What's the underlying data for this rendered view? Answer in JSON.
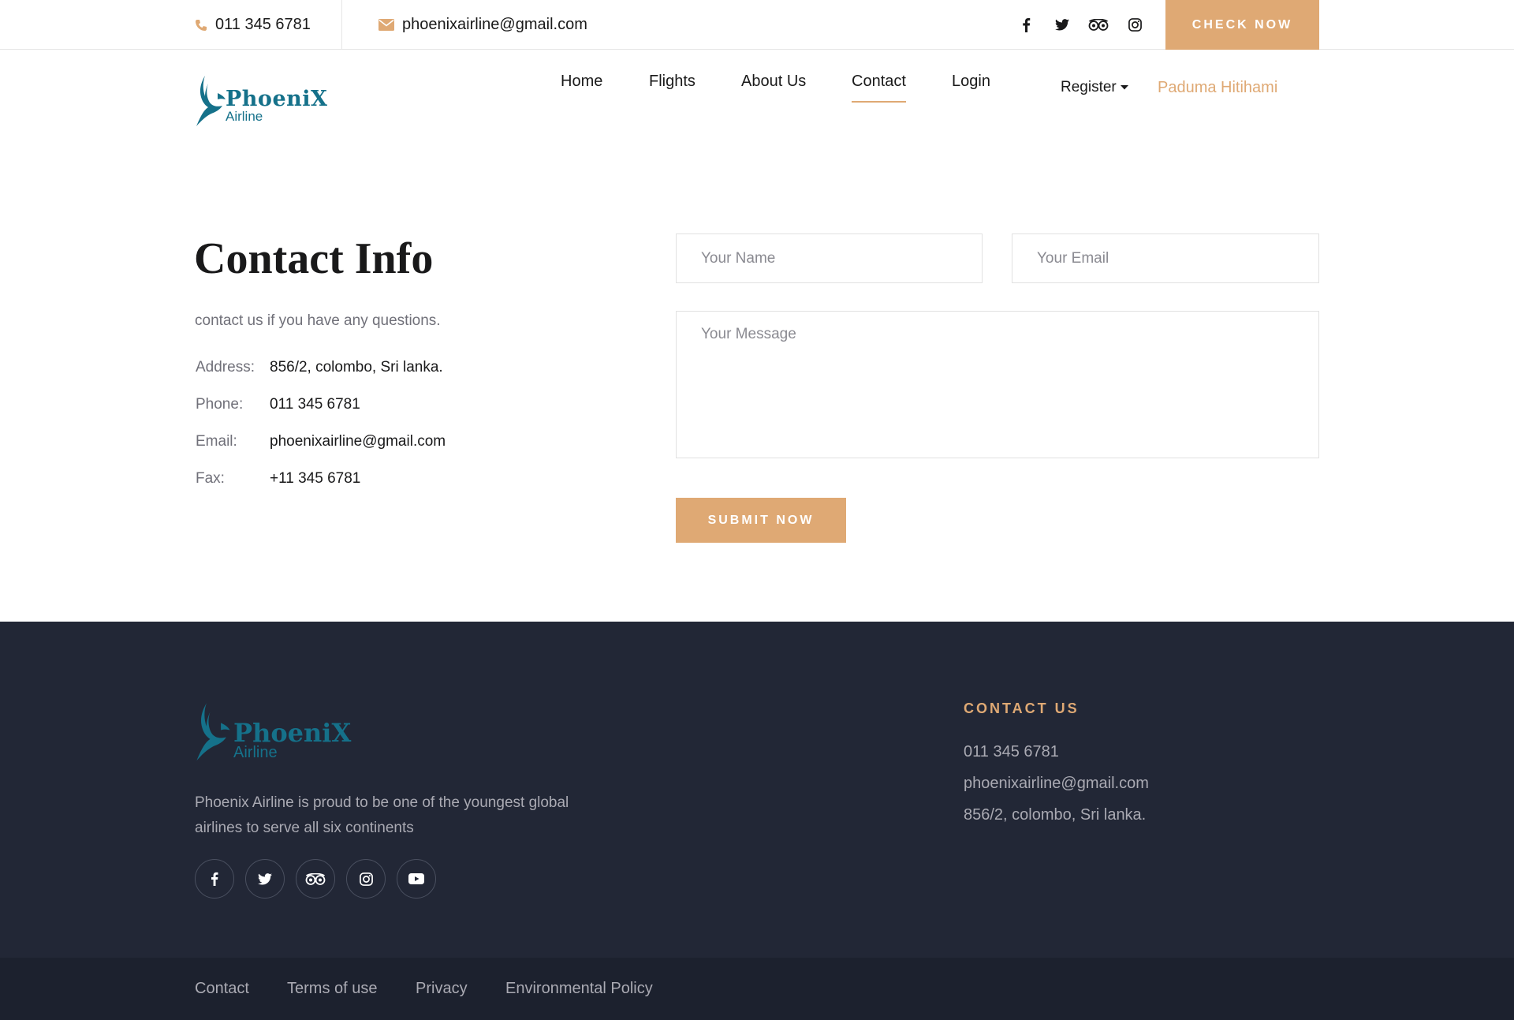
{
  "topbar": {
    "phone": "011 345 6781",
    "email": "phoenixairline@gmail.com",
    "social_icons": [
      "facebook-icon",
      "twitter-icon",
      "tripadvisor-icon",
      "instagram-icon"
    ],
    "cta_label": "CHECK NOW"
  },
  "header": {
    "logo_main": "PhoeniX",
    "logo_sub": "Airline",
    "nav": [
      "Home",
      "Flights",
      "About Us",
      "Contact",
      "Login"
    ],
    "active_nav": "Contact",
    "register_label": "Register",
    "user_name": "Paduma Hitihami"
  },
  "contact_info": {
    "title": "Contact Info",
    "subtitle": "contact us if you have any questions.",
    "rows": [
      {
        "label": "Address:",
        "value": "856/2, colombo, Sri lanka."
      },
      {
        "label": "Phone:",
        "value": "011 345 6781"
      },
      {
        "label": "Email:",
        "value": "phoenixairline@gmail.com"
      },
      {
        "label": "Fax:",
        "value": "+11 345 6781"
      }
    ]
  },
  "form": {
    "name_placeholder": "Your Name",
    "email_placeholder": "Your Email",
    "message_placeholder": "Your Message",
    "submit_label": "SUBMIT NOW"
  },
  "footer": {
    "logo_main": "PhoeniX",
    "logo_sub": "Airline",
    "about": "Phoenix Airline is proud to be one of the youngest global airlines to serve all six continents",
    "social_icons": [
      "facebook-icon",
      "twitter-icon",
      "tripadvisor-icon",
      "instagram-icon",
      "youtube-icon"
    ],
    "contact_heading": "CONTACT US",
    "contact_lines": [
      "011 345 6781",
      "phoenixairline@gmail.com",
      "856/2, colombo, Sri lanka."
    ],
    "bottom_links": [
      "Contact",
      "Terms of use",
      "Privacy",
      "Environmental Policy"
    ]
  },
  "colors": {
    "accent": "#dfa974",
    "brand_teal": "#15718a",
    "footer_bg": "#222736",
    "bottom_bar_bg": "#1c212e"
  }
}
